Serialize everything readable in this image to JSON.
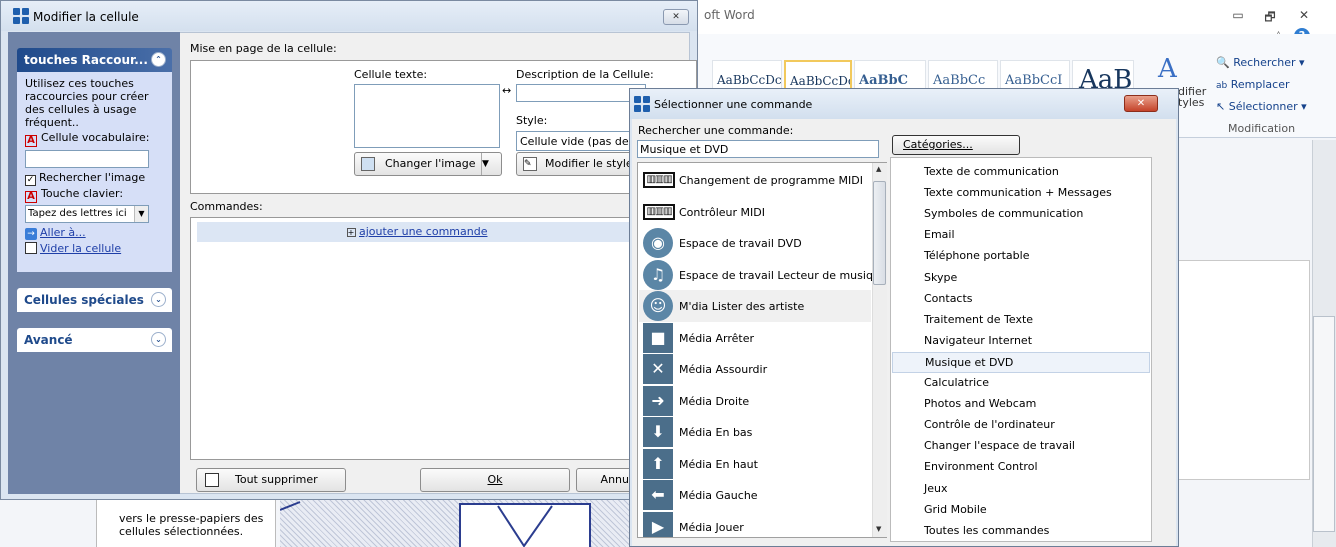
{
  "word": {
    "title": "oft Word",
    "minimize_icon": "minimize-icon",
    "restore_icon": "restore-icon",
    "close_icon": "close-icon",
    "help_icon": "help-icon",
    "styles": [
      "AaBbCcDc",
      "AaBbCcDc",
      "AaBbC",
      "AaBbCc",
      "AaBbCcI",
      "AaB"
    ],
    "change_styles": "difier\ntyles",
    "find": "Rechercher",
    "replace": "Remplacer",
    "select": "Sélectionner",
    "editing_group": "Modification",
    "doc_lines": [
      "vers le presse-papiers des",
      "cellules sélectionnées."
    ]
  },
  "dlg1": {
    "title": "Modifier la cellule",
    "tasks": {
      "group1_title": "touches Raccour...",
      "group1_desc": [
        "Utilisez ces touches",
        "raccourcies pour créer",
        "des cellules à usage",
        "fréquent.."
      ],
      "vocab_cell": "Cellule vocabulaire:",
      "vocab_value": "",
      "search_image": "Rechercher l'image",
      "key_label": "Touche clavier:",
      "key_combo": "Tapez des lettres ici",
      "goto": "Aller à...",
      "clear_cell": "Vider la cellule",
      "group2_title": "Cellules spéciales",
      "group3_title": "Avancé"
    },
    "layout_label": "Mise en page de la cellule:",
    "cell_text_label": "Cellule texte:",
    "cell_desc_label": "Description de la Cellule:",
    "style_label": "Style:",
    "style_value": "Cellule vide (pas de style)",
    "change_image": "Changer l'image",
    "modify_style": "Modifier le style",
    "commands_label": "Commandes:",
    "add_command": "ajouter une commande",
    "delete_all": "Tout supprimer",
    "ok": "Ok",
    "cancel": "Annu"
  },
  "dlg2": {
    "title": "Sélectionner une commande",
    "search_label": "Rechercher une commande:",
    "search_value": "Musique et DVD",
    "categories_button": "Catégories...",
    "commands": [
      {
        "label": "Changement de programme MIDI",
        "icon": "midi-keyboard-icon"
      },
      {
        "label": "Contrôleur MIDI",
        "icon": "midi-keyboard-icon"
      },
      {
        "label": "Espace de travail DVD",
        "icon": "dvd-disc-icon"
      },
      {
        "label": "Espace de travail Lecteur de musique",
        "icon": "music-note-icon"
      },
      {
        "label": "M'dia Lister des artiste",
        "icon": "artist-icon"
      },
      {
        "label": "Média Arrêter",
        "icon": "stop-icon"
      },
      {
        "label": "Média Assourdir",
        "icon": "mute-icon"
      },
      {
        "label": "Média Droite",
        "icon": "arrow-right-icon"
      },
      {
        "label": "Média En bas",
        "icon": "arrow-down-icon"
      },
      {
        "label": "Média En haut",
        "icon": "arrow-up-icon"
      },
      {
        "label": "Média Gauche",
        "icon": "arrow-left-icon"
      },
      {
        "label": "Média Jouer",
        "icon": "play-icon"
      }
    ],
    "categories": [
      "Texte de communication",
      "Texte communication + Messages",
      "Symboles de communication",
      "Email",
      "Téléphone portable",
      "Skype",
      "Contacts",
      "Traitement de Texte",
      "Navigateur Internet",
      "Musique et DVD",
      "Calculatrice",
      "Photos and Webcam",
      "Contrôle de l'ordinateur",
      "Changer l'espace de travail",
      "Environment Control",
      "Jeux",
      "Grid Mobile",
      "Toutes les commandes"
    ],
    "selected_category": "Musique et DVD"
  },
  "colors": {
    "task_pane": "#6f83a7",
    "task_header": "#1f4a8b",
    "close_red": "#c4432a"
  }
}
